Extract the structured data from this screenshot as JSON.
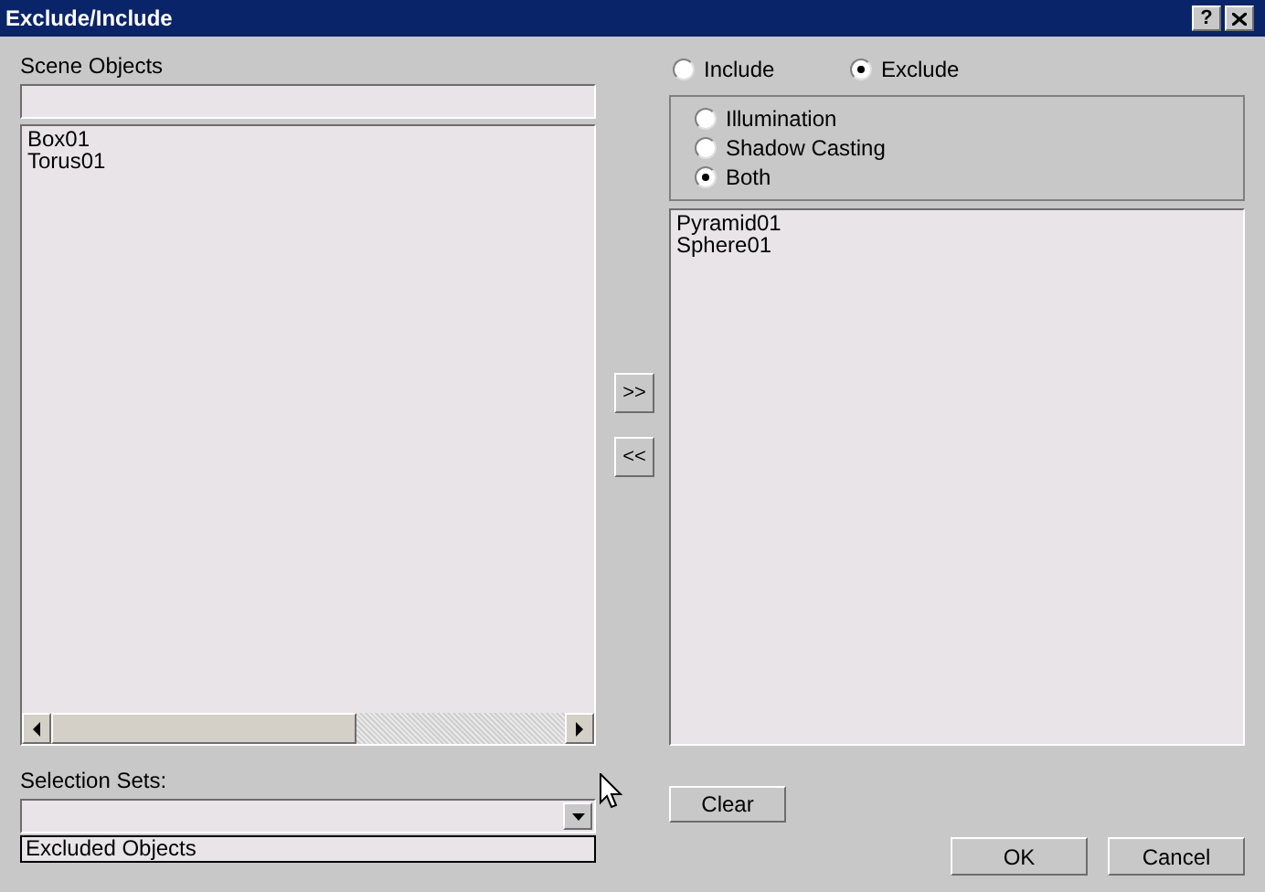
{
  "window": {
    "title": "Exclude/Include",
    "help_button": "?"
  },
  "scene_objects": {
    "label": "Scene Objects",
    "items": [
      "Box01",
      "Torus01"
    ]
  },
  "transfer_buttons": [
    ">>",
    "<<"
  ],
  "mode": [
    {
      "label": "Include",
      "selected": false
    },
    {
      "label": "Exclude",
      "selected": true
    }
  ],
  "target": [
    {
      "label": "Illumination",
      "selected": false
    },
    {
      "label": "Shadow Casting",
      "selected": false
    },
    {
      "label": "Both",
      "selected": true
    }
  ],
  "excluded_list": {
    "items": [
      "Pyramid01",
      "Sphere01"
    ]
  },
  "selection_sets": {
    "label": "Selection Sets:",
    "dropdown_items": [
      "Excluded Objects"
    ]
  },
  "clear_button": "Clear",
  "buttons": [
    "OK",
    "Cancel"
  ]
}
